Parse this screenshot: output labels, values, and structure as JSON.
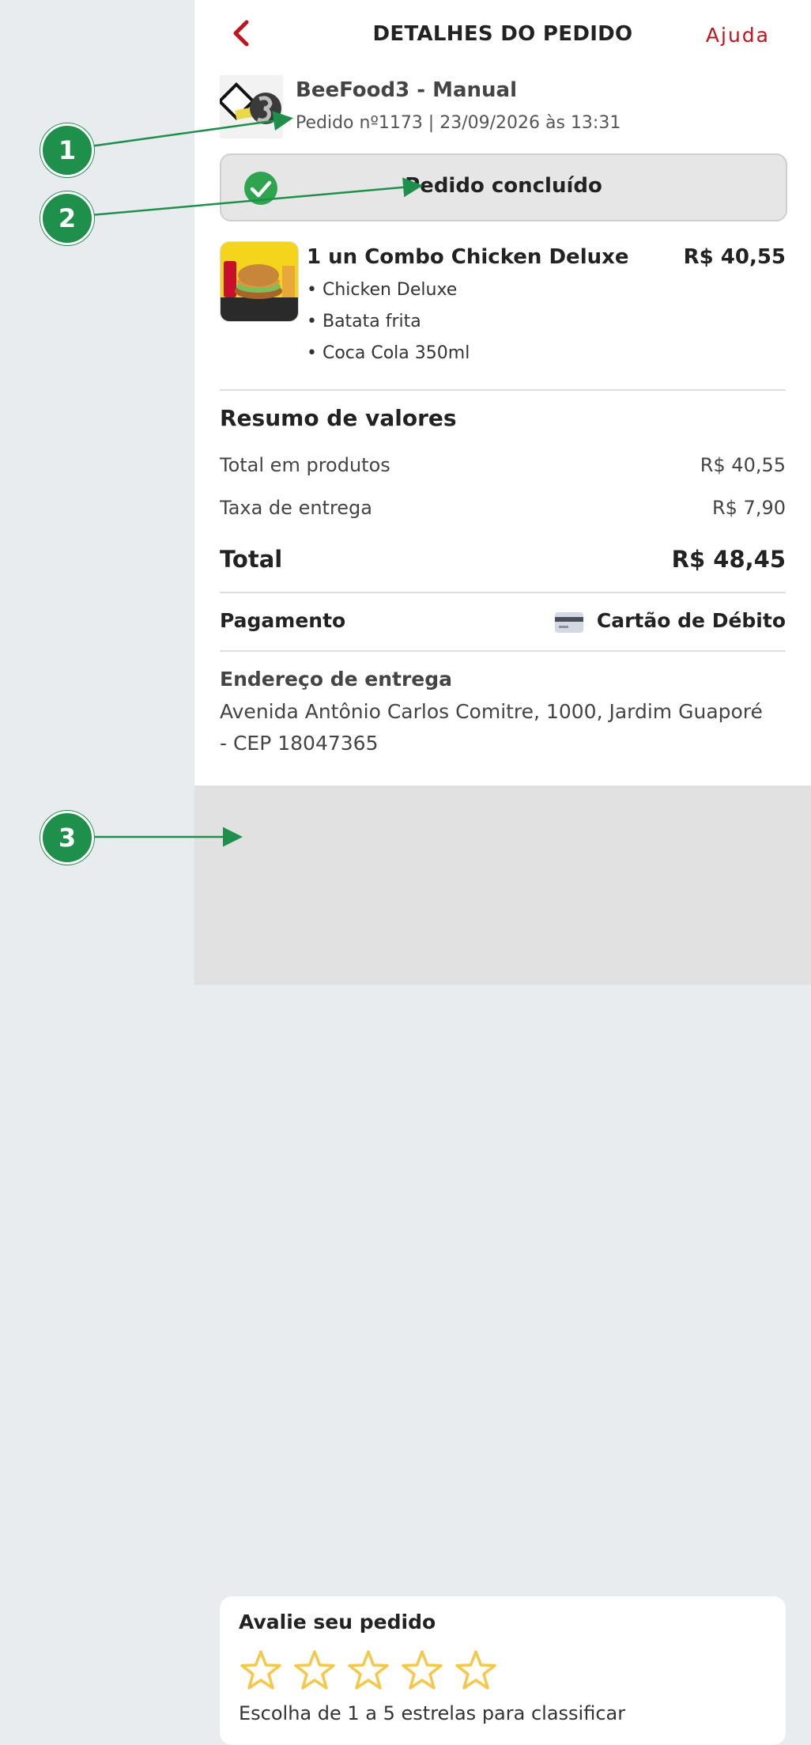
{
  "header": {
    "title": "DETALHES DO PEDIDO",
    "help_label": "Ajuda",
    "back_icon": "chevron-left-icon"
  },
  "store": {
    "name": "BeeFood3 - Manual",
    "order_meta": "Pedido nº1173 | 23/09/2026 às 13:31"
  },
  "status": {
    "text": "Pedido concluído",
    "icon": "check-circle-icon",
    "color": "#2ea44f"
  },
  "product": {
    "name": "1 un Combo Chicken Deluxe",
    "price": "R$ 40,55",
    "items": [
      "• Chicken Deluxe",
      "• Batata frita",
      "• Coca Cola 350ml"
    ]
  },
  "summary": {
    "title": "Resumo de valores",
    "rows": [
      {
        "label": "Total em produtos",
        "value": "R$ 40,55"
      },
      {
        "label": "Taxa de entrega",
        "value": "R$ 7,90"
      }
    ],
    "total_label": "Total",
    "total_value": "R$ 48,45"
  },
  "payment": {
    "label": "Pagamento",
    "method": "Cartão de Débito",
    "icon": "credit-card-icon"
  },
  "address": {
    "title": "Endereço de entrega",
    "text": "Avenida Antônio Carlos Comitre, 1000, Jardim Guaporé - CEP 18047365"
  },
  "rating": {
    "title": "Avalie seu pedido",
    "hint": "Escolha de 1 a 5 estrelas para classificar",
    "stars_total": 5,
    "selected": 0,
    "star_color": "#f5c84b"
  },
  "annotations": {
    "labels": [
      "1",
      "2",
      "3"
    ],
    "color": "#1f8f4c"
  },
  "colors": {
    "accent_red": "#c0141f",
    "panel_bg": "#ffffff",
    "side_bg": "#e9ecef"
  }
}
